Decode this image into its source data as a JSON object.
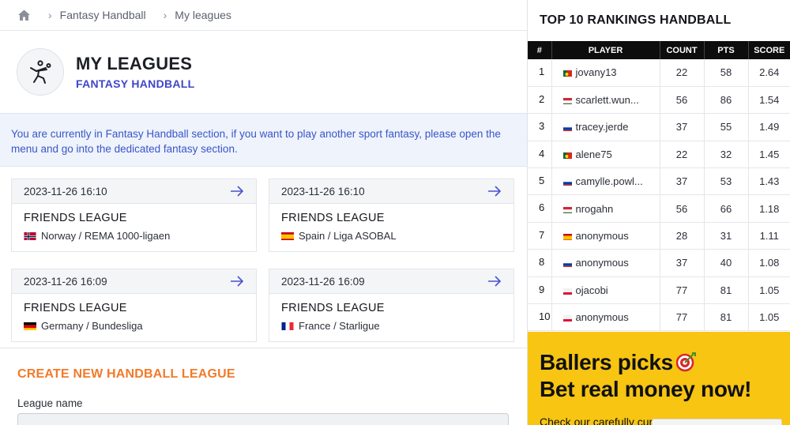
{
  "breadcrumb": {
    "items": [
      "Fantasy Handball",
      "My leagues"
    ]
  },
  "header": {
    "title": "MY LEAGUES",
    "subtitle": "FANTASY HANDBALL"
  },
  "info_text": "You are currently in Fantasy Handball section, if you want to play another sport fantasy, please open the menu and go into the dedicated fantasy section.",
  "leagues": [
    {
      "date": "2023-11-26 16:10",
      "title": "FRIENDS LEAGUE",
      "country_league": "Norway / REMA 1000-ligaen",
      "flag": "norway"
    },
    {
      "date": "2023-11-26 16:10",
      "title": "FRIENDS LEAGUE",
      "country_league": "Spain / Liga ASOBAL",
      "flag": "spain"
    },
    {
      "date": "2023-11-26 16:09",
      "title": "FRIENDS LEAGUE",
      "country_league": "Germany / Bundesliga",
      "flag": "germany"
    },
    {
      "date": "2023-11-26 16:09",
      "title": "FRIENDS LEAGUE",
      "country_league": "France / Starligue",
      "flag": "france"
    }
  ],
  "create": {
    "title": "CREATE NEW HANDBALL LEAGUE",
    "name_label": "League name"
  },
  "rankings": {
    "title": "TOP 10 RANKINGS HANDBALL",
    "headers": [
      "#",
      "PLAYER",
      "COUNT",
      "PTS",
      "SCORE"
    ],
    "rows": [
      {
        "pos": "1",
        "player": "jovany13",
        "flag": "portugal",
        "count": "22",
        "pts": "58",
        "score": "2.64"
      },
      {
        "pos": "2",
        "player": "scarlett.wun...",
        "flag": "hungary",
        "count": "56",
        "pts": "86",
        "score": "1.54"
      },
      {
        "pos": "3",
        "player": "tracey.jerde",
        "flag": "russia",
        "count": "37",
        "pts": "55",
        "score": "1.49"
      },
      {
        "pos": "4",
        "player": "alene75",
        "flag": "portugal",
        "count": "22",
        "pts": "32",
        "score": "1.45"
      },
      {
        "pos": "5",
        "player": "camylle.powl...",
        "flag": "russia",
        "count": "37",
        "pts": "53",
        "score": "1.43"
      },
      {
        "pos": "6",
        "player": "nrogahn",
        "flag": "hungary",
        "count": "56",
        "pts": "66",
        "score": "1.18"
      },
      {
        "pos": "7",
        "player": "anonymous",
        "flag": "spain",
        "count": "28",
        "pts": "31",
        "score": "1.11"
      },
      {
        "pos": "8",
        "player": "anonymous",
        "flag": "russia",
        "count": "37",
        "pts": "40",
        "score": "1.08"
      },
      {
        "pos": "9",
        "player": "ojacobi",
        "flag": "poland",
        "count": "77",
        "pts": "81",
        "score": "1.05"
      },
      {
        "pos": "10",
        "player": "anonymous",
        "flag": "poland",
        "count": "77",
        "pts": "81",
        "score": "1.05"
      }
    ]
  },
  "promo": {
    "line1": "Ballers picks",
    "line2": "Bet real money now!",
    "line3": "Check our carefully cur",
    "icon": "dart-target-icon"
  },
  "colors": {
    "accent": "#3f46c8",
    "create": "#f27a2a",
    "promo": "#f7c512",
    "info_bg": "#eef3fc",
    "info_text": "#3b55c7"
  }
}
